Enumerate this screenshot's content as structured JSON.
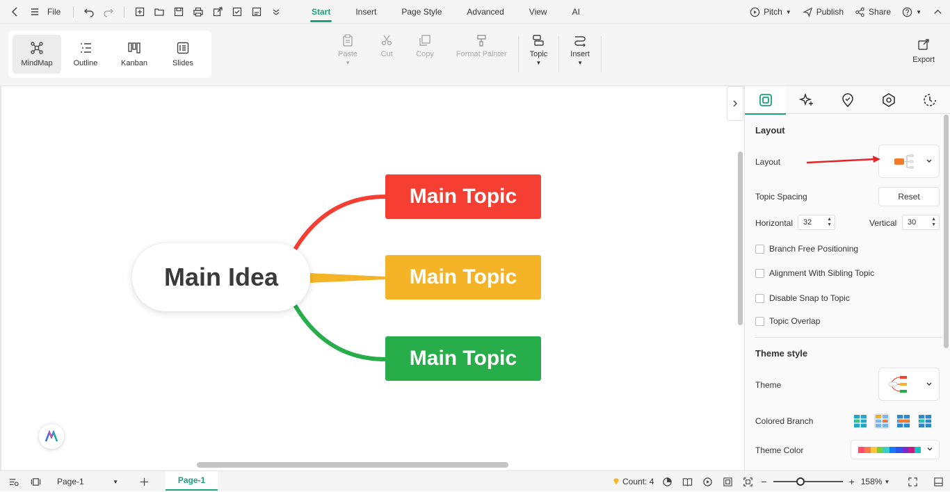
{
  "toolbar": {
    "file_label": "File"
  },
  "menu": {
    "tabs": [
      "Start",
      "Insert",
      "Page Style",
      "Advanced",
      "View",
      "AI"
    ],
    "active": "Start"
  },
  "header_right": {
    "pitch": "Pitch",
    "publish": "Publish",
    "share": "Share"
  },
  "views": [
    {
      "label": "MindMap",
      "icon": "mindmap-icon",
      "active": true
    },
    {
      "label": "Outline",
      "icon": "outline-icon",
      "active": false
    },
    {
      "label": "Kanban",
      "icon": "kanban-icon",
      "active": false
    },
    {
      "label": "Slides",
      "icon": "slides-icon",
      "active": false
    }
  ],
  "ribbon": {
    "paste": "Paste",
    "cut": "Cut",
    "copy": "Copy",
    "format_painter": "Format Painter",
    "topic": "Topic",
    "insert": "Insert",
    "export": "Export"
  },
  "mindmap": {
    "main_idea": "Main Idea",
    "topics": [
      {
        "label": "Main Topic",
        "color": "#f43f32"
      },
      {
        "label": "Main Topic",
        "color": "#f5b428"
      },
      {
        "label": "Main Topic",
        "color": "#27ae4a"
      }
    ]
  },
  "panel": {
    "tabs": [
      "format-icon",
      "ai-sparkle-icon",
      "mark-icon",
      "theme-icon",
      "clock-icon"
    ],
    "layout_heading": "Layout",
    "layout_label": "Layout",
    "topic_spacing_label": "Topic Spacing",
    "reset_label": "Reset",
    "horizontal_label": "Horizontal",
    "horizontal_value": "32",
    "vertical_label": "Vertical",
    "vertical_value": "30",
    "checkboxes": [
      "Branch Free Positioning",
      "Alignment With Sibling Topic",
      "Disable Snap to Topic",
      "Topic Overlap"
    ],
    "theme_heading": "Theme style",
    "theme_label": "Theme",
    "colored_branch_label": "Colored Branch",
    "theme_color_label": "Theme Color",
    "theme_colors": [
      "#ff4f6e",
      "#ff7a45",
      "#ffc53d",
      "#73d13d",
      "#36cfc9",
      "#1677ff",
      "#2f54eb",
      "#722ed1",
      "#c41d7f",
      "#13c2c2"
    ]
  },
  "status": {
    "page_select": "Page-1",
    "page_tab": "Page-1",
    "count": "Count: 4",
    "zoom": "158%"
  },
  "colors": {
    "accent": "#1aa37a",
    "annotation_arrow": "#e0262b"
  }
}
